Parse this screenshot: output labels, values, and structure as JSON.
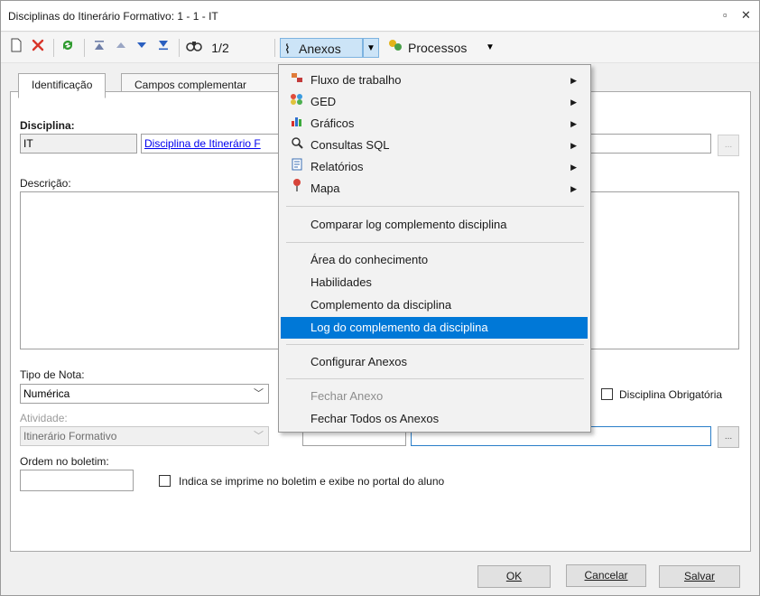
{
  "window": {
    "title": "Disciplinas do Itinerário Formativo: 1 - 1 - IT",
    "restore_glyph": "▫",
    "close_glyph": "✕"
  },
  "toolbar": {
    "icons": [
      "new-icon",
      "delete-icon",
      "refresh-icon",
      "first-icon",
      "previous-icon",
      "next-icon",
      "last-icon",
      "search-icon"
    ],
    "record_position": "1/2",
    "anexos_label": "Anexos",
    "processos_label": "Processos"
  },
  "tabs": [
    {
      "label": "Identificação",
      "active": true
    },
    {
      "label": "Campos complementar"
    }
  ],
  "form": {
    "disciplina_label": "Disciplina:",
    "disciplina_code": "IT",
    "disciplina_link": "Disciplina de Itinerário F",
    "descricao_label": "Descrição:",
    "tipo_nota_label": "Tipo de Nota:",
    "tipo_nota_value": "Numérica",
    "disciplina_obrigatoria_label": "Disciplina Obrigatória",
    "atividade_label": "Atividade:",
    "atividade_value": "Itinerário Formativo",
    "ordem_label": "Ordem no boletim:",
    "imprime_label": "Indica se imprime no boletim e exibe no portal do aluno",
    "dots_label": "..."
  },
  "buttons": {
    "ok": "OK",
    "cancelar": "Cancelar",
    "salvar": "Salvar"
  },
  "menu": {
    "items": [
      {
        "label": "Fluxo de trabalho",
        "icon": "workflow-icon",
        "submenu": true
      },
      {
        "label": "GED",
        "icon": "ged-icon",
        "submenu": true
      },
      {
        "label": "Gráficos",
        "icon": "chart-icon",
        "submenu": true
      },
      {
        "label": "Consultas SQL",
        "icon": "sql-query-icon",
        "submenu": true
      },
      {
        "label": "Relatórios",
        "icon": "report-icon",
        "submenu": true
      },
      {
        "label": "Mapa",
        "icon": "map-pin-icon",
        "submenu": true
      },
      {
        "label": "Comparar log complemento disciplina"
      },
      {
        "label": "Área do conhecimento"
      },
      {
        "label": "Habilidades"
      },
      {
        "label": "Complemento da disciplina"
      },
      {
        "label": "Log do complemento da disciplina",
        "highlighted": true
      },
      {
        "label": "Configurar Anexos"
      },
      {
        "label": "Fechar Anexo",
        "disabled": true
      },
      {
        "label": "Fechar Todos os Anexos"
      }
    ]
  },
  "colors": {
    "highlight": "#0078d7",
    "link": "#0000ee",
    "focus_border": "#2a7ec8"
  }
}
